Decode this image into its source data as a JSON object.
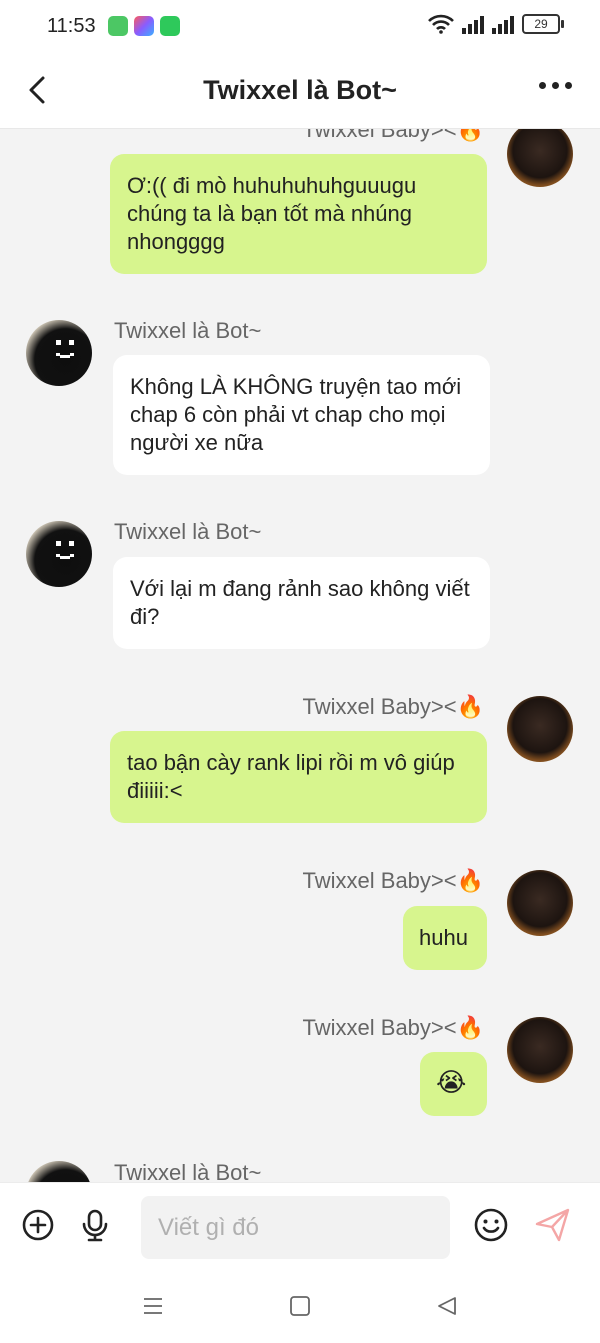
{
  "status": {
    "time": "11:53",
    "battery": "29"
  },
  "header": {
    "title": "Twixxel là Bot~"
  },
  "messages": [
    {
      "sender": "Twixxel Baby><🔥",
      "text": "Ơ:(( đi mò huhuhuhuhguuugu chúng ta là bạn tốt mà nhúng nhongggg"
    },
    {
      "sender": "Twixxel là Bot~",
      "text": "Không LÀ KHÔNG truyện tao mới chap 6 còn phải vt chap cho mọi người xe nữa"
    },
    {
      "sender": "Twixxel là Bot~",
      "text": "Với lại m đang rảnh sao không viết đi?"
    },
    {
      "sender": "Twixxel Baby><🔥",
      "text": "tao bận cày rank lipi rồi m vô giúp điiiii:<"
    },
    {
      "sender": "Twixxel Baby><🔥",
      "text": "huhu"
    },
    {
      "sender": "Twixxel Baby><🔥",
      "text": "😭"
    },
    {
      "sender": "Twixxel là Bot~",
      "text": ""
    }
  ],
  "input": {
    "placeholder": "Viết gì đó"
  },
  "colors": {
    "bubble_self": "#d7f58e",
    "bubble_other": "#ffffff",
    "background": "#f3f3f3"
  },
  "icons": [
    "back-icon",
    "more-icon",
    "add-icon",
    "mic-icon",
    "emoji-icon",
    "send-icon",
    "menu-icon",
    "home-icon",
    "back-nav-icon"
  ]
}
